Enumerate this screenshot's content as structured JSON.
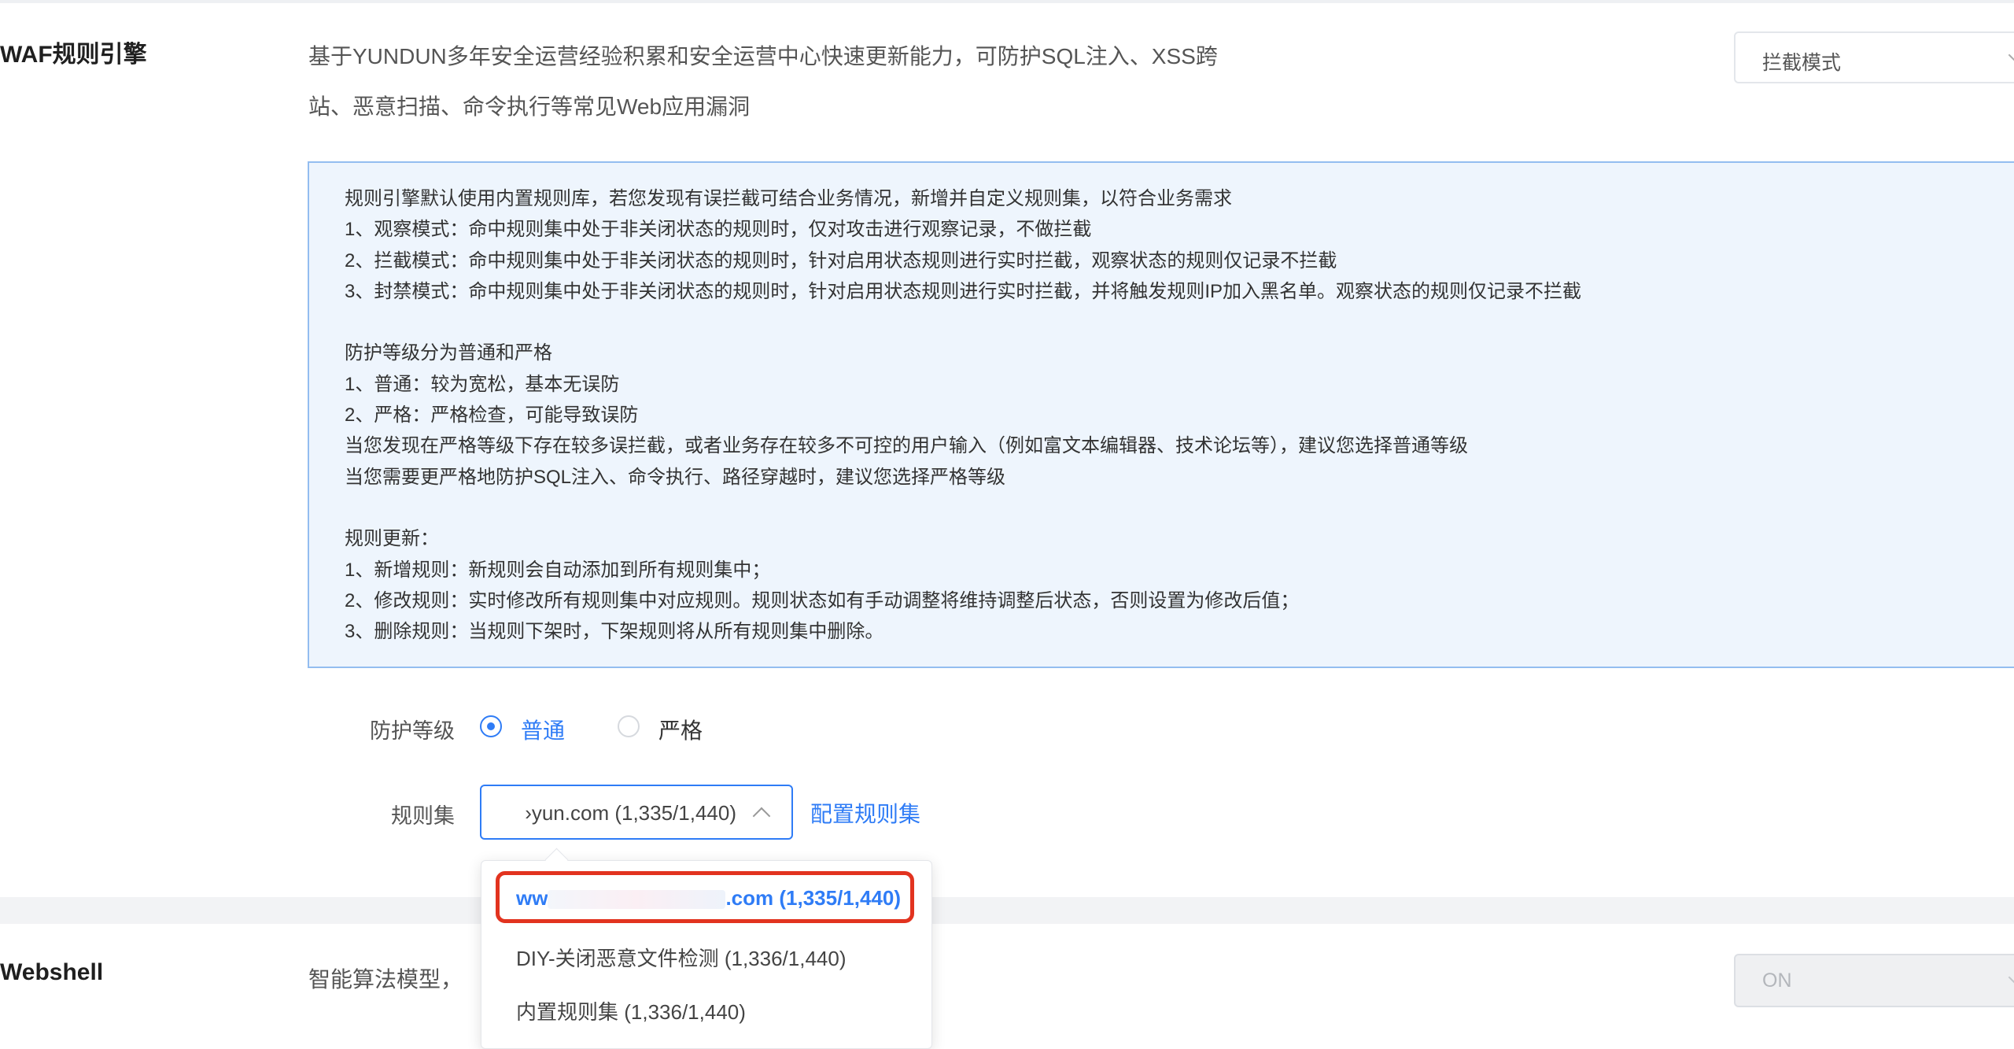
{
  "waf": {
    "title": "WAF规则引擎",
    "desc_line1": "基于YUNDUN多年安全运营经验积累和安全运营中心快速更新能力，可防护SQL注入、XSS跨",
    "desc_line2": "站、恶意扫描、命令执行等常见Web应用漏洞",
    "mode_select_value": "拦截模式"
  },
  "info": {
    "lines": [
      "规则引擎默认使用内置规则库，若您发现有误拦截可结合业务情况，新增并自定义规则集，以符合业务需求",
      "1、观察模式：命中规则集中处于非关闭状态的规则时，仅对攻击进行观察记录，不做拦截",
      "2、拦截模式：命中规则集中处于非关闭状态的规则时，针对启用状态规则进行实时拦截，观察状态的规则仅记录不拦截",
      "3、封禁模式：命中规则集中处于非关闭状态的规则时，针对启用状态规则进行实时拦截，并将触发规则IP加入黑名单。观察状态的规则仅记录不拦截",
      "",
      "防护等级分为普通和严格",
      "1、普通：较为宽松，基本无误防",
      "2、严格：严格检查，可能导致误防",
      "当您发现在严格等级下存在较多误拦截，或者业务存在较多不可控的用户输入（例如富文本编辑器、技术论坛等），建议您选择普通等级",
      "当您需要更严格地防护SQL注入、命令执行、路径穿越时，建议您选择严格等级",
      "",
      "规则更新：",
      "1、新增规则：新规则会自动添加到所有规则集中；",
      "2、修改规则：实时修改所有规则集中对应规则。规则状态如有手动调整将维持调整后状态，否则设置为修改后值；",
      "3、删除规则：当规则下架时，下架规则将从所有规则集中删除。"
    ]
  },
  "form": {
    "level_label": "防护等级",
    "level_normal": "普通",
    "level_strict": "严格",
    "level_selected": "普通",
    "ruleset_label": "规则集",
    "ruleset_value": "›yun.com (1,335/1,440)",
    "config_link": "配置规则集"
  },
  "dropdown": {
    "items": [
      {
        "prefix": "ww",
        "suffix": ".com (1,335/1,440)",
        "selected": true
      },
      {
        "label": "DIY-关闭恶意文件检测 (1,336/1,440)",
        "selected": false
      },
      {
        "label": "内置规则集 (1,336/1,440)",
        "selected": false
      }
    ]
  },
  "webshell": {
    "title": "Webshell",
    "desc": "智能算法模型，",
    "select_value": "ON"
  },
  "colors": {
    "accent": "#2f7cf6",
    "highlight": "#e2331f",
    "info_bg": "#eef5fd",
    "info_border": "#93bdf0"
  }
}
